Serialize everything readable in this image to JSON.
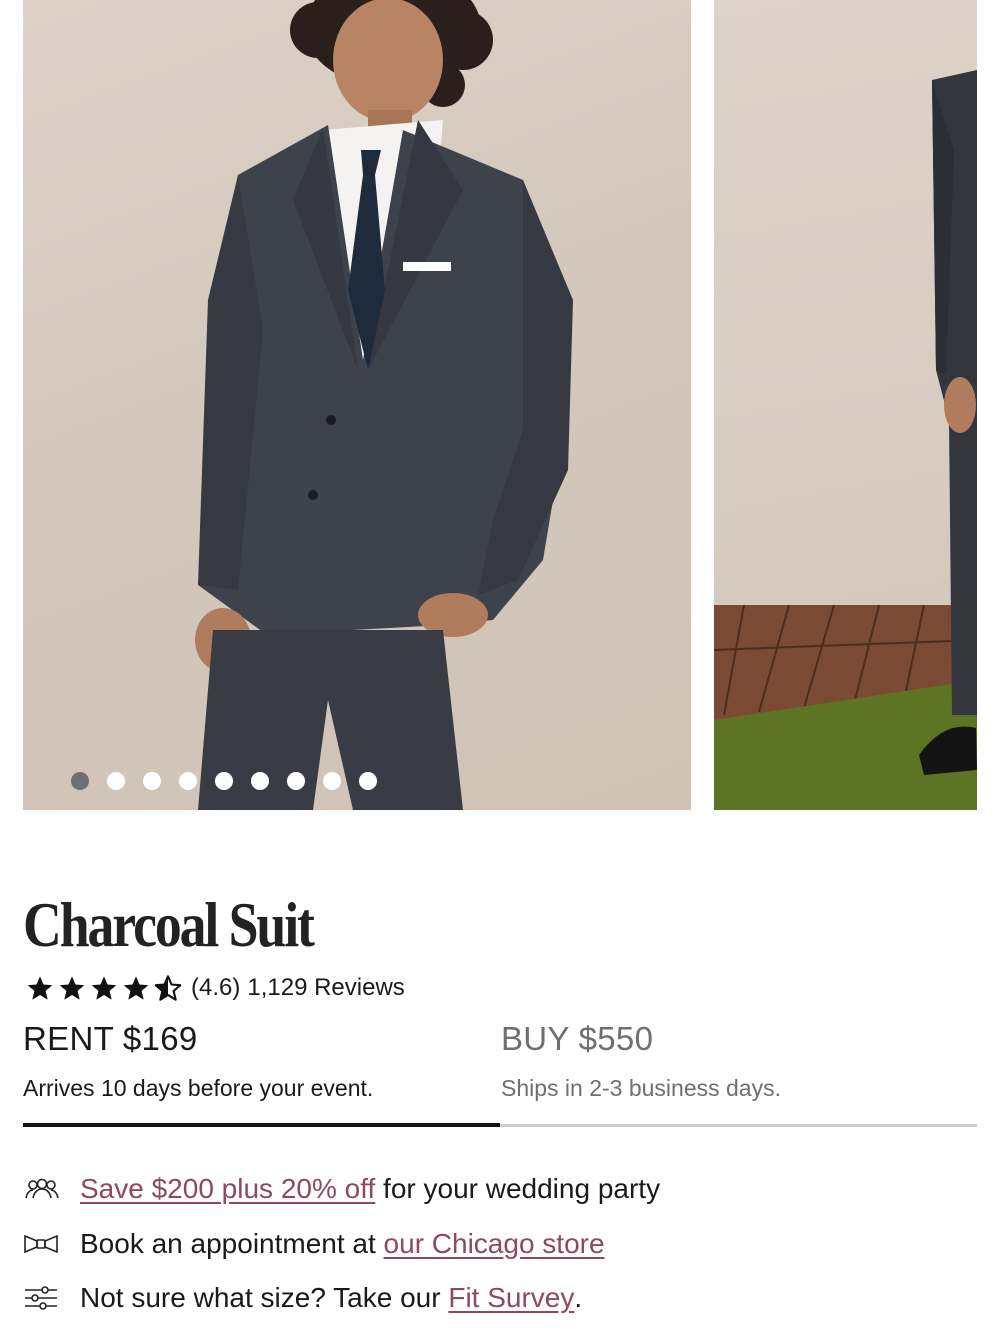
{
  "gallery": {
    "main_photo_alt": "Model wearing charcoal suit",
    "second_photo_alt": "Model wearing charcoal suit, full length",
    "dot_count": 9,
    "active_dot": 0
  },
  "product": {
    "title": "Charcoal Suit",
    "rating_value": 4.6,
    "rating_score": "(4.6)",
    "reviews": "1,129 Reviews"
  },
  "options": {
    "rent_price": "RENT $169",
    "rent_note": "Arrives 10 days before your event.",
    "buy_price": "BUY $550",
    "buy_note": "Ships in 2-3 business days."
  },
  "perks": {
    "wedding_link": "Save $200 plus 20% off",
    "wedding_text": " for your wedding party",
    "appointment_text": "Book an appointment at ",
    "appointment_link": "our Chicago store",
    "size_text": "Not sure what size? Take our ",
    "size_link": "Fit Survey",
    "size_end": "."
  },
  "colors": {
    "link": "#8f4860",
    "active_tab": "#141414",
    "inactive_tab": "#d0ccc6"
  }
}
